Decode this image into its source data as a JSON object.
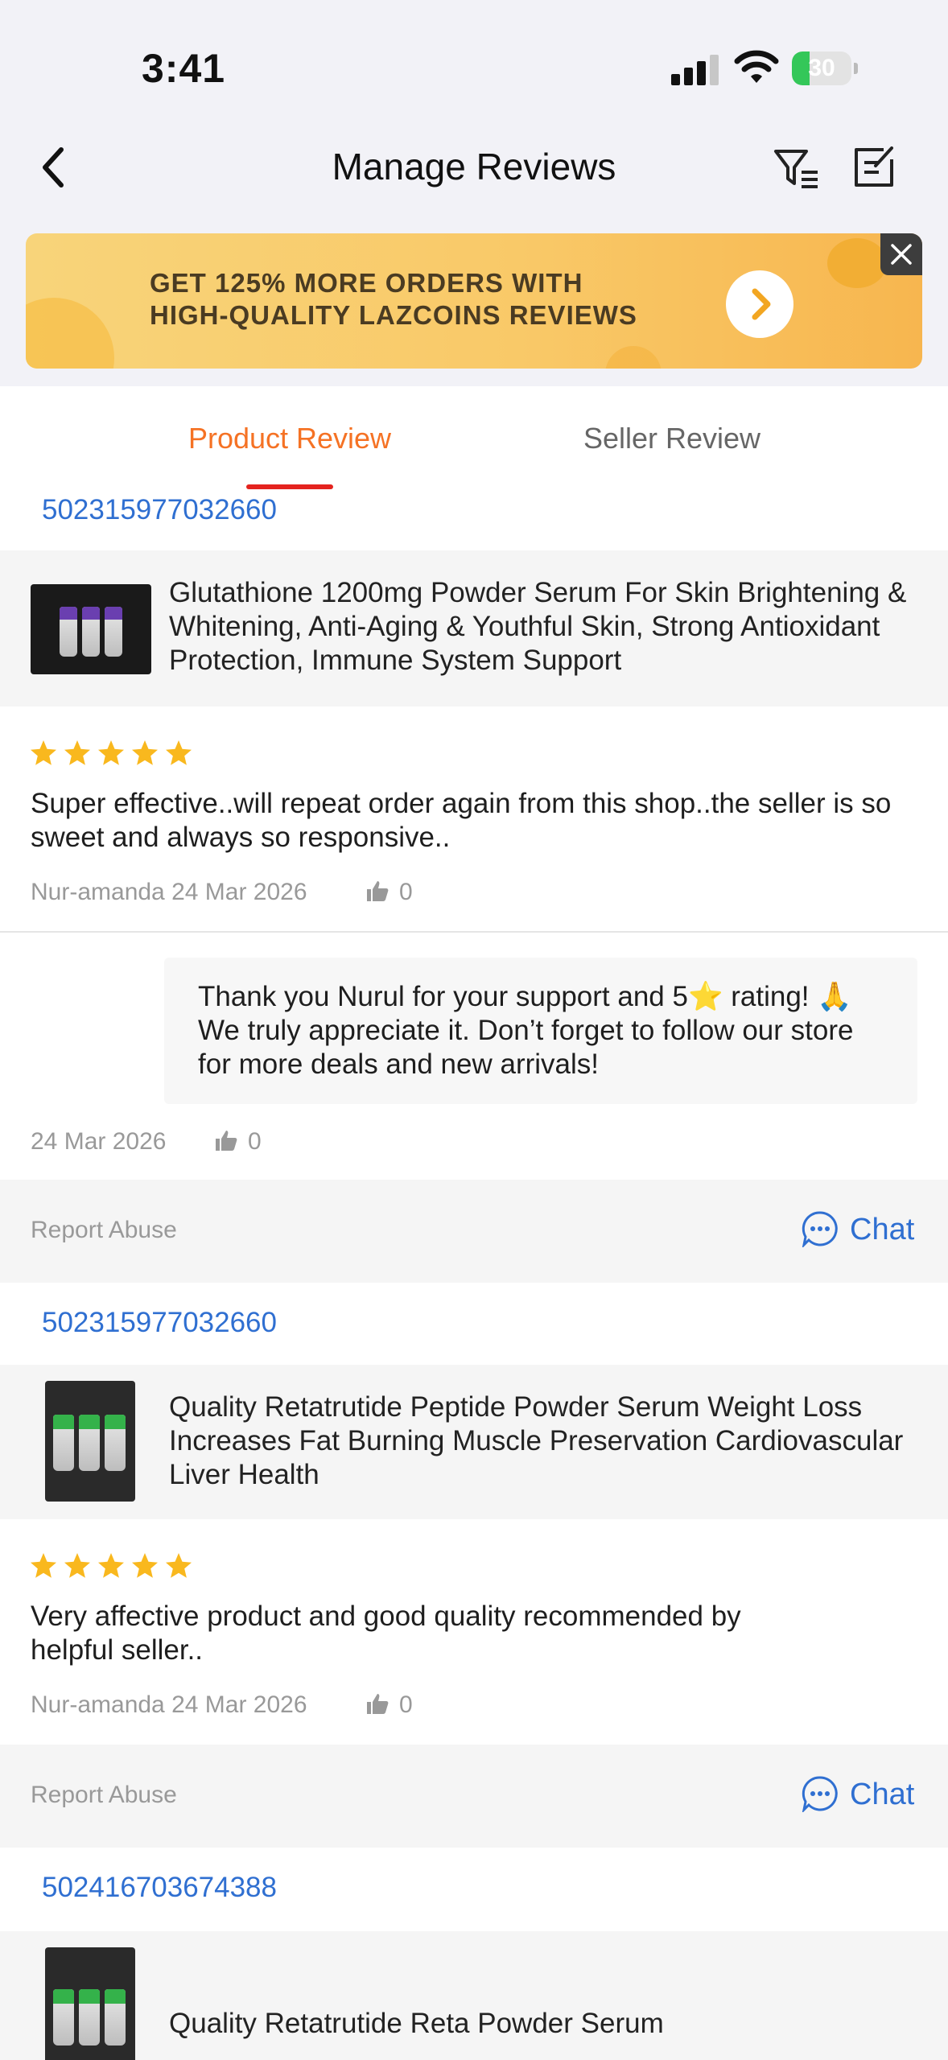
{
  "status_bar": {
    "time": "3:41",
    "battery": "30",
    "battery_level": 0.3
  },
  "nav": {
    "title": "Manage Reviews"
  },
  "banner": {
    "line1": "GET 125% MORE ORDERS WITH",
    "line2": "HIGH-QUALITY LAZCOINS REVIEWS"
  },
  "tabs": {
    "product": "Product Review",
    "seller": "Seller Review"
  },
  "reviews": [
    {
      "order_id": "502315977032660",
      "product": "Glutathione 1200mg Powder Serum For Skin Brightening & Whitening, Anti-Aging & Youthful Skin, Strong Antioxidant Protection, Immune System Support",
      "rating": 5,
      "text": "Super effective..will repeat order again from this shop..the seller is so sweet and always so responsive..",
      "author_date": "Nur-amanda 24 Mar 2026",
      "likes": "0",
      "reply": {
        "text": "Thank you Nurul for your support and 5⭐️ rating! 🙏 We truly appreciate it. Don’t forget to follow our store for more deals and new arrivals!",
        "date": "24 Mar 2026",
        "likes": "0"
      },
      "report": "Report Abuse",
      "chat": "Chat"
    },
    {
      "order_id": "502315977032660",
      "product": "Quality Retatrutide Peptide Powder Serum Weight Loss Increases Fat Burning Muscle Preservation Cardiovascular Liver Health",
      "rating": 5,
      "text": "Very affective product and good quality recommended by helpful seller..",
      "author_date": "Nur-amanda 24 Mar 2026",
      "likes": "0",
      "report": "Report Abuse",
      "chat": "Chat"
    },
    {
      "order_id": "502416703674388",
      "product": "Quality Retatrutide Reta Powder Serum"
    }
  ],
  "colors": {
    "accent": "#f57224",
    "link": "#2f6fd1",
    "star": "#f9b81e",
    "tab_underline": "#e4231e"
  }
}
